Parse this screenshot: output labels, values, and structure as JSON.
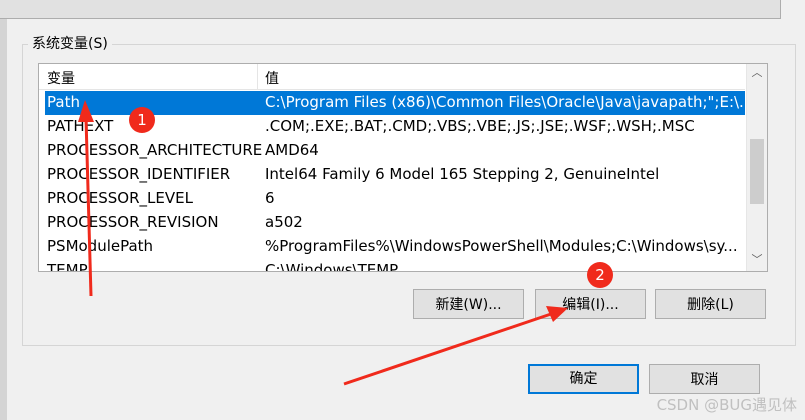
{
  "group": {
    "label": "系统变量(S)"
  },
  "list": {
    "columns": [
      "变量",
      "值"
    ],
    "rows": [
      {
        "name": "Path",
        "value": "C:\\Program Files (x86)\\Common Files\\Oracle\\Java\\javapath;\";E:\\...",
        "selected": true
      },
      {
        "name": "PATHEXT",
        "value": ".COM;.EXE;.BAT;.CMD;.VBS;.VBE;.JS;.JSE;.WSF;.WSH;.MSC"
      },
      {
        "name": "PROCESSOR_ARCHITECTURE",
        "value": "AMD64"
      },
      {
        "name": "PROCESSOR_IDENTIFIER",
        "value": "Intel64 Family 6 Model 165 Stepping 2, GenuineIntel"
      },
      {
        "name": "PROCESSOR_LEVEL",
        "value": "6"
      },
      {
        "name": "PROCESSOR_REVISION",
        "value": "a502"
      },
      {
        "name": "PSModulePath",
        "value": "%ProgramFiles%\\WindowsPowerShell\\Modules;C:\\Windows\\sy..."
      },
      {
        "name": "TEMP",
        "value": "C:\\Windows\\TEMP"
      }
    ]
  },
  "buttons": {
    "new": "新建(W)...",
    "edit": "编辑(I)...",
    "delete": "删除(L)",
    "ok": "确定",
    "cancel": "取消"
  },
  "badges": [
    "1",
    "2"
  ],
  "annotation_color": "#f02a1c",
  "selection_color": "#0078d7",
  "watermark": "CSDN @BUG遇见体"
}
